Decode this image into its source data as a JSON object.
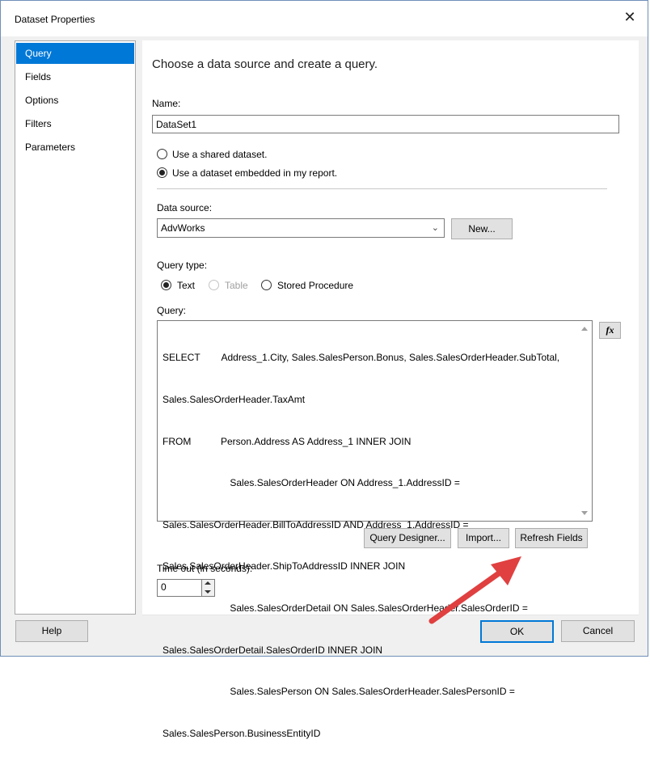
{
  "window": {
    "title": "Dataset Properties"
  },
  "nav": {
    "items": [
      "Query",
      "Fields",
      "Options",
      "Filters",
      "Parameters"
    ],
    "selected": "Query"
  },
  "main": {
    "heading": "Choose a data source and create a query.",
    "name_label": "Name:",
    "name_value": "DataSet1",
    "radio_shared": "Use a shared dataset.",
    "radio_embedded": "Use a dataset embedded in my report.",
    "data_source_label": "Data source:",
    "data_source_value": "AdvWorks",
    "new_button": "New...",
    "query_type_label": "Query type:",
    "qt_text": "Text",
    "qt_table": "Table",
    "qt_stored": "Stored Procedure",
    "query_label": "Query:",
    "query_lines": [
      "SELECT        Address_1.City, Sales.SalesPerson.Bonus, Sales.SalesOrderHeader.SubTotal,",
      "Sales.SalesOrderHeader.TaxAmt",
      "FROM           Person.Address AS Address_1 INNER JOIN",
      "                         Sales.SalesOrderHeader ON Address_1.AddressID =",
      "Sales.SalesOrderHeader.BillToAddressID AND Address_1.AddressID =",
      "Sales.SalesOrderHeader.ShipToAddressID INNER JOIN",
      "                         Sales.SalesOrderDetail ON Sales.SalesOrderHeader.SalesOrderID =",
      "Sales.SalesOrderDetail.SalesOrderID INNER JOIN",
      "                         Sales.SalesPerson ON Sales.SalesOrderHeader.SalesPersonID =",
      "Sales.SalesPerson.BusinessEntityID"
    ],
    "fx_button": "fx",
    "query_designer_button": "Query Designer...",
    "import_button": "Import...",
    "refresh_fields_button": "Refresh Fields",
    "timeout_label": "Time out (in seconds):",
    "timeout_value": "0"
  },
  "footer": {
    "help": "Help",
    "ok": "OK",
    "cancel": "Cancel"
  },
  "colors": {
    "accent": "#0078d7",
    "annotation_arrow": "#e04040"
  }
}
